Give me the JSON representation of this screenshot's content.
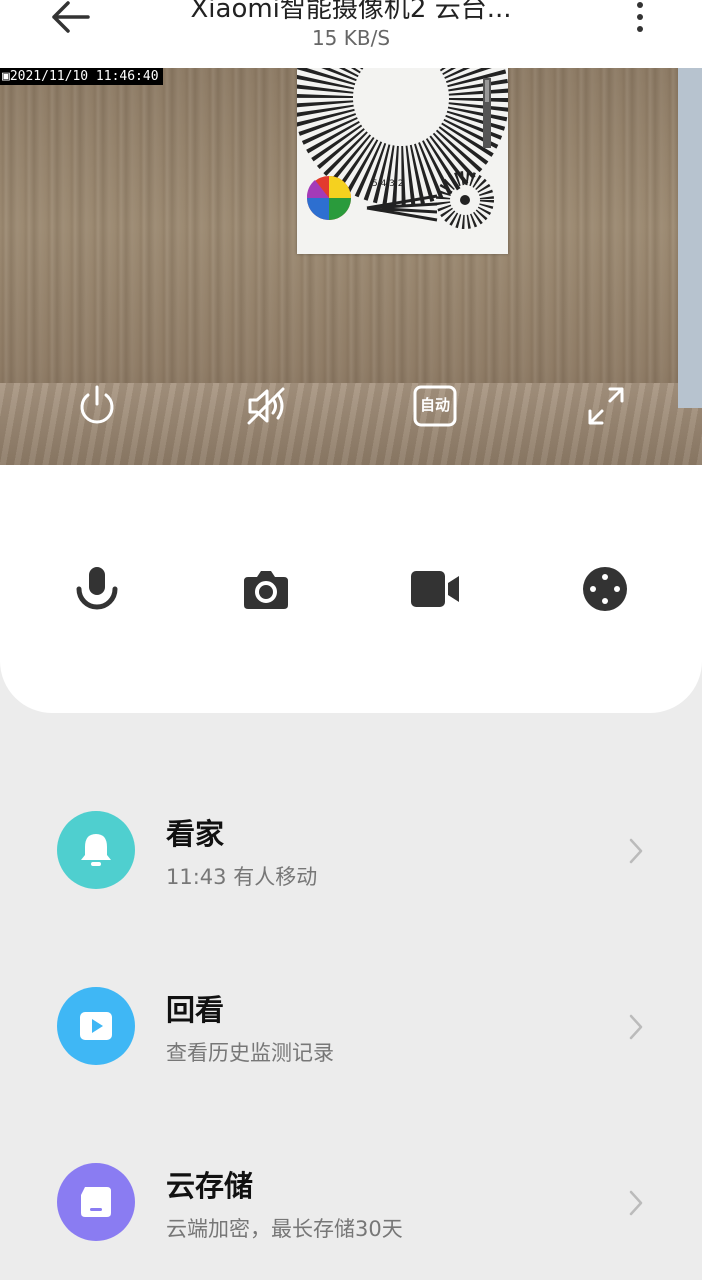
{
  "header": {
    "title": "Xiaomi智能摄像机2 云台...",
    "subtitle": "15 KB/S",
    "back_icon": "arrow-left-icon",
    "more_icon": "more-vertical-icon"
  },
  "video": {
    "timestamp": "2021/11/10 11:46:40",
    "controls": [
      {
        "name": "power-icon"
      },
      {
        "name": "mute-icon"
      },
      {
        "name": "quality-button",
        "label": "自动"
      },
      {
        "name": "fullscreen-icon"
      }
    ]
  },
  "actions": [
    {
      "name": "microphone-icon"
    },
    {
      "name": "camera-icon"
    },
    {
      "name": "video-record-icon"
    },
    {
      "name": "ptz-direction-icon"
    }
  ],
  "rows": [
    {
      "title": "看家",
      "subtitle": "11:43 有人移动",
      "icon": "bell-icon",
      "color": "#4fcfcf"
    },
    {
      "title": "回看",
      "subtitle": "查看历史监测记录",
      "icon": "play-icon",
      "color": "#3fb7f5"
    },
    {
      "title": "云存储",
      "subtitle": "云端加密，最长存储30天",
      "icon": "cloud-storage-icon",
      "color": "#8a7cf2"
    }
  ]
}
